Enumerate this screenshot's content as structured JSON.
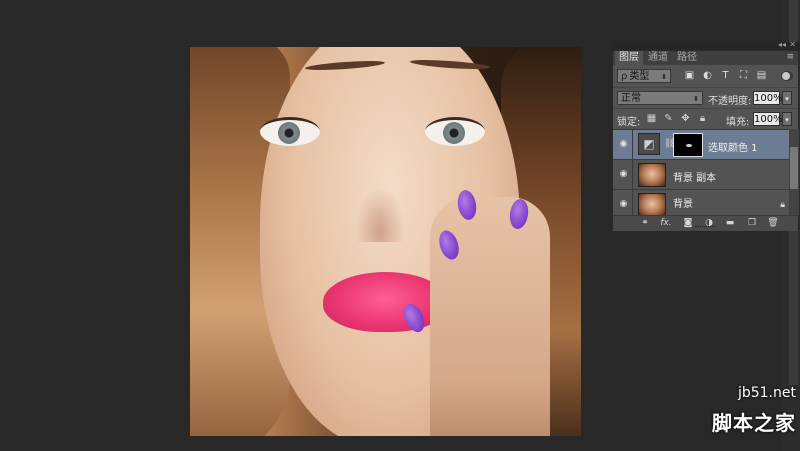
{
  "panel": {
    "tabs": [
      "图层",
      "通道",
      "路径"
    ],
    "filter": {
      "search_glyph": "ρ",
      "value": "类型"
    },
    "blend_mode": "正常",
    "opacity_label": "不透明度:",
    "opacity_value": "100%",
    "lock_label": "锁定:",
    "fill_label": "填充:",
    "fill_value": "100%",
    "layers": [
      {
        "name": "选取颜色 1",
        "type": "adjustment",
        "selected": true
      },
      {
        "name": "背景 副本",
        "type": "photo",
        "selected": false
      },
      {
        "name": "背景",
        "type": "photo",
        "selected": false,
        "locked": true
      }
    ],
    "bottom_icons": [
      "link-icon",
      "fx-icon",
      "mask-icon",
      "adjustment-icon",
      "folder-icon",
      "new-layer-icon",
      "trash-icon"
    ],
    "bottom_fx_label": "fx."
  },
  "canvas": {
    "description_alt": "portrait photo"
  },
  "watermark": {
    "url": "jb51.net",
    "name": "脚本之家"
  },
  "colors": {
    "workspace_bg": "#282828",
    "panel_bg": "#535353",
    "selected_row": "#6c7d93",
    "nail_color": "#7b3cc7",
    "lip_color": "#e8336f"
  }
}
